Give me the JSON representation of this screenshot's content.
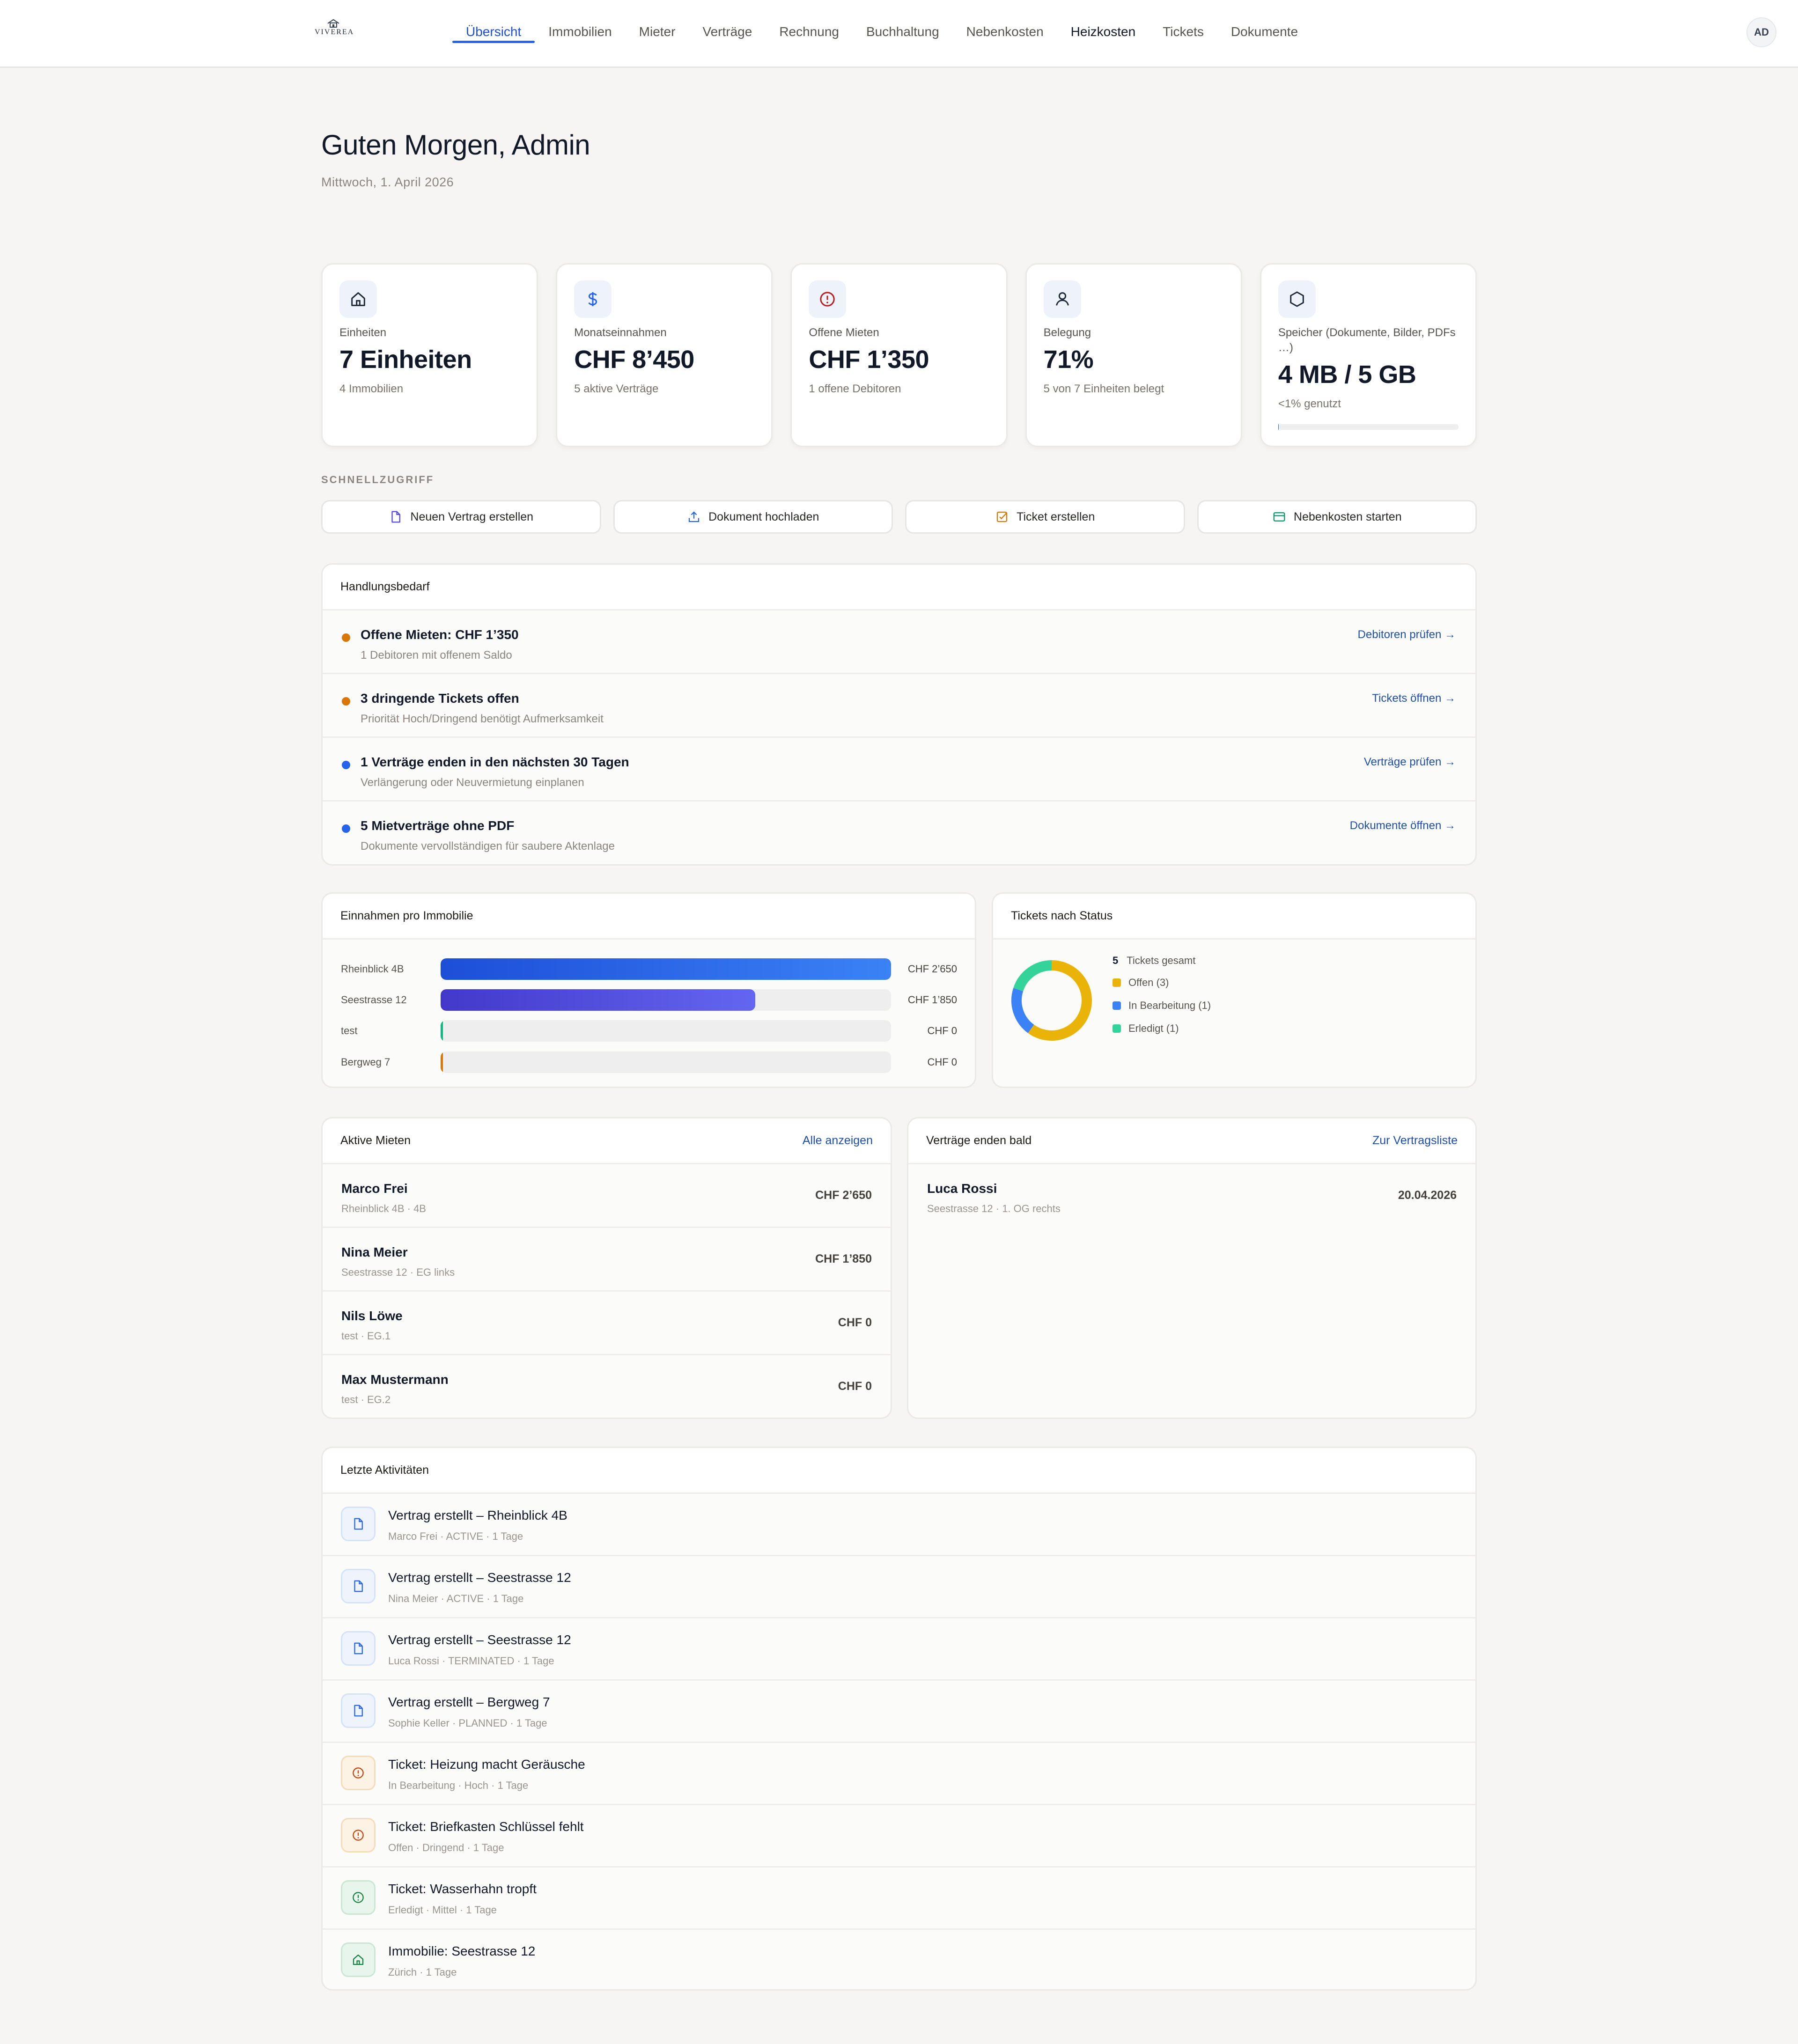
{
  "app": {
    "logo_text": "VIVEREA"
  },
  "nav": {
    "items": [
      {
        "label": "Übersicht",
        "active": true
      },
      {
        "label": "Immobilien"
      },
      {
        "label": "Mieter"
      },
      {
        "label": "Verträge"
      },
      {
        "label": "Rechnung"
      },
      {
        "label": "Buchhaltung"
      },
      {
        "label": "Nebenkosten"
      },
      {
        "label": "Heizkosten",
        "emphasis": true
      },
      {
        "label": "Tickets"
      },
      {
        "label": "Dokumente"
      }
    ],
    "avatar_initials": "AD"
  },
  "greeting": {
    "title": "Guten Morgen, Admin",
    "date": "Mittwoch, 1. April 2026"
  },
  "stats": [
    {
      "icon": "home-icon",
      "label": "Einheiten",
      "value": "7 Einheiten",
      "sub": "4 Immobilien",
      "icon_color": "#1f2937"
    },
    {
      "icon": "dollar-icon",
      "label": "Monatseinnahmen",
      "value": "CHF 8’450",
      "sub": "5 aktive Verträge",
      "icon_color": "#2563eb"
    },
    {
      "icon": "alert-circle-icon",
      "label": "Offene Mieten",
      "value": "CHF 1’350",
      "sub": "1 offene Debitoren",
      "icon_color": "#b91c1c"
    },
    {
      "icon": "user-icon",
      "label": "Belegung",
      "value": "71%",
      "sub": "5 von 7 Einheiten belegt",
      "icon_color": "#1f2937"
    },
    {
      "icon": "hexagon-icon",
      "label": "Speicher (Dokumente, Bilder, PDFs …)",
      "value": "4 MB / 5 GB",
      "sub": "<1% genutzt",
      "icon_color": "#1f2937",
      "usage_fraction": 0.0008
    }
  ],
  "quick_access": {
    "label": "SCHNELLZUGRIFF",
    "buttons": [
      {
        "label": "Neuen Vertrag erstellen",
        "icon": "document-icon",
        "color": "#4f46e5"
      },
      {
        "label": "Dokument hochladen",
        "icon": "upload-icon",
        "color": "#2563eb"
      },
      {
        "label": "Ticket erstellen",
        "icon": "checkbox-icon",
        "color": "#d97706"
      },
      {
        "label": "Nebenkosten starten",
        "icon": "credit-card-icon",
        "color": "#059669"
      }
    ]
  },
  "action_needed": {
    "title": "Handlungsbedarf",
    "items": [
      {
        "title": "Offene Mieten: CHF 1’350",
        "sub": "1 Debitoren mit offenem Saldo",
        "link": "Debitoren prüfen →",
        "dot": "#d97706"
      },
      {
        "title": "3 dringende Tickets offen",
        "sub": "Priorität Hoch/Dringend benötigt Aufmerksamkeit",
        "link": "Tickets öffnen →",
        "dot": "#d97706"
      },
      {
        "title": "1 Verträge enden in den nächsten 30 Tagen",
        "sub": "Verlängerung oder Neuvermietung einplanen",
        "link": "Verträge prüfen →",
        "dot": "#2563eb"
      },
      {
        "title": "5 Mietverträge ohne PDF",
        "sub": "Dokumente vervollständigen für saubere Aktenlage",
        "link": "Dokumente öffnen →",
        "dot": "#2563eb"
      }
    ]
  },
  "income_chart": {
    "title": "Einnahmen pro Immobilie",
    "value_labels": [
      "CHF 2’650",
      "CHF 1’850",
      "CHF 0",
      "CHF 0"
    ],
    "colors": [
      [
        "#1d4ed8",
        "#3b82f6"
      ],
      [
        "#4338ca",
        "#6366f1"
      ],
      [
        "#10b981",
        "#10b981"
      ],
      [
        "#d97706",
        "#d97706"
      ]
    ]
  },
  "chart_data": {
    "type": "bar",
    "orientation": "horizontal",
    "title": "Einnahmen pro Immobilie",
    "categories": [
      "Rheinblick 4B",
      "Seestrasse 12",
      "test",
      "Bergweg 7"
    ],
    "values": [
      2650,
      1850,
      0,
      0
    ],
    "unit": "CHF",
    "xlim": [
      0,
      2650
    ]
  },
  "tickets_chart": {
    "title": "Tickets nach Status",
    "total": "5",
    "total_label": "Tickets gesamt",
    "segments": [
      {
        "label": "Offen (3)",
        "value": 3,
        "color": "#eab308"
      },
      {
        "label": "In Bearbeitung (1)",
        "value": 1,
        "color": "#3b82f6"
      },
      {
        "label": "Erledigt (1)",
        "value": 1,
        "color": "#34d399"
      }
    ]
  },
  "active_rents": {
    "title": "Aktive Mieten",
    "link": "Alle anzeigen",
    "rows": [
      {
        "name": "Marco Frei",
        "sub": "Rheinblick 4B · 4B",
        "amount": "CHF 2’650"
      },
      {
        "name": "Nina Meier",
        "sub": "Seestrasse 12 · EG links",
        "amount": "CHF 1’850"
      },
      {
        "name": "Nils Löwe",
        "sub": "test · EG.1",
        "amount": "CHF 0"
      },
      {
        "name": "Max Mustermann",
        "sub": "test · EG.2",
        "amount": "CHF 0"
      }
    ]
  },
  "contracts_ending": {
    "title": "Verträge enden bald",
    "link": "Zur Vertragsliste",
    "rows": [
      {
        "name": "Luca Rossi",
        "sub": "Seestrasse 12 · 1. OG rechts",
        "date": "20.04.2026"
      }
    ]
  },
  "activities": {
    "title": "Letzte Aktivitäten",
    "rows": [
      {
        "title": "Vertrag erstellt – Rheinblick 4B",
        "sub": "Marco Frei · ACTIVE · 1 Tage",
        "icon": "document-icon",
        "tone": "blue"
      },
      {
        "title": "Vertrag erstellt – Seestrasse 12",
        "sub": "Nina Meier · ACTIVE · 1 Tage",
        "icon": "document-icon",
        "tone": "blue"
      },
      {
        "title": "Vertrag erstellt – Seestrasse 12",
        "sub": "Luca Rossi · TERMINATED · 1 Tage",
        "icon": "document-icon",
        "tone": "blue"
      },
      {
        "title": "Vertrag erstellt – Bergweg 7",
        "sub": "Sophie Keller · PLANNED · 1 Tage",
        "icon": "document-icon",
        "tone": "blue"
      },
      {
        "title": "Ticket: Heizung macht Geräusche",
        "sub": "In Bearbeitung · Hoch · 1 Tage",
        "icon": "alert-circle-icon",
        "tone": "orange"
      },
      {
        "title": "Ticket: Briefkasten Schlüssel fehlt",
        "sub": "Offen · Dringend · 1 Tage",
        "icon": "alert-circle-icon",
        "tone": "orange"
      },
      {
        "title": "Ticket: Wasserhahn tropft",
        "sub": "Erledigt · Mittel · 1 Tage",
        "icon": "alert-circle-icon",
        "tone": "green"
      },
      {
        "title": "Immobilie: Seestrasse 12",
        "sub": "Zürich · 1 Tage",
        "icon": "home-icon",
        "tone": "green"
      }
    ]
  }
}
